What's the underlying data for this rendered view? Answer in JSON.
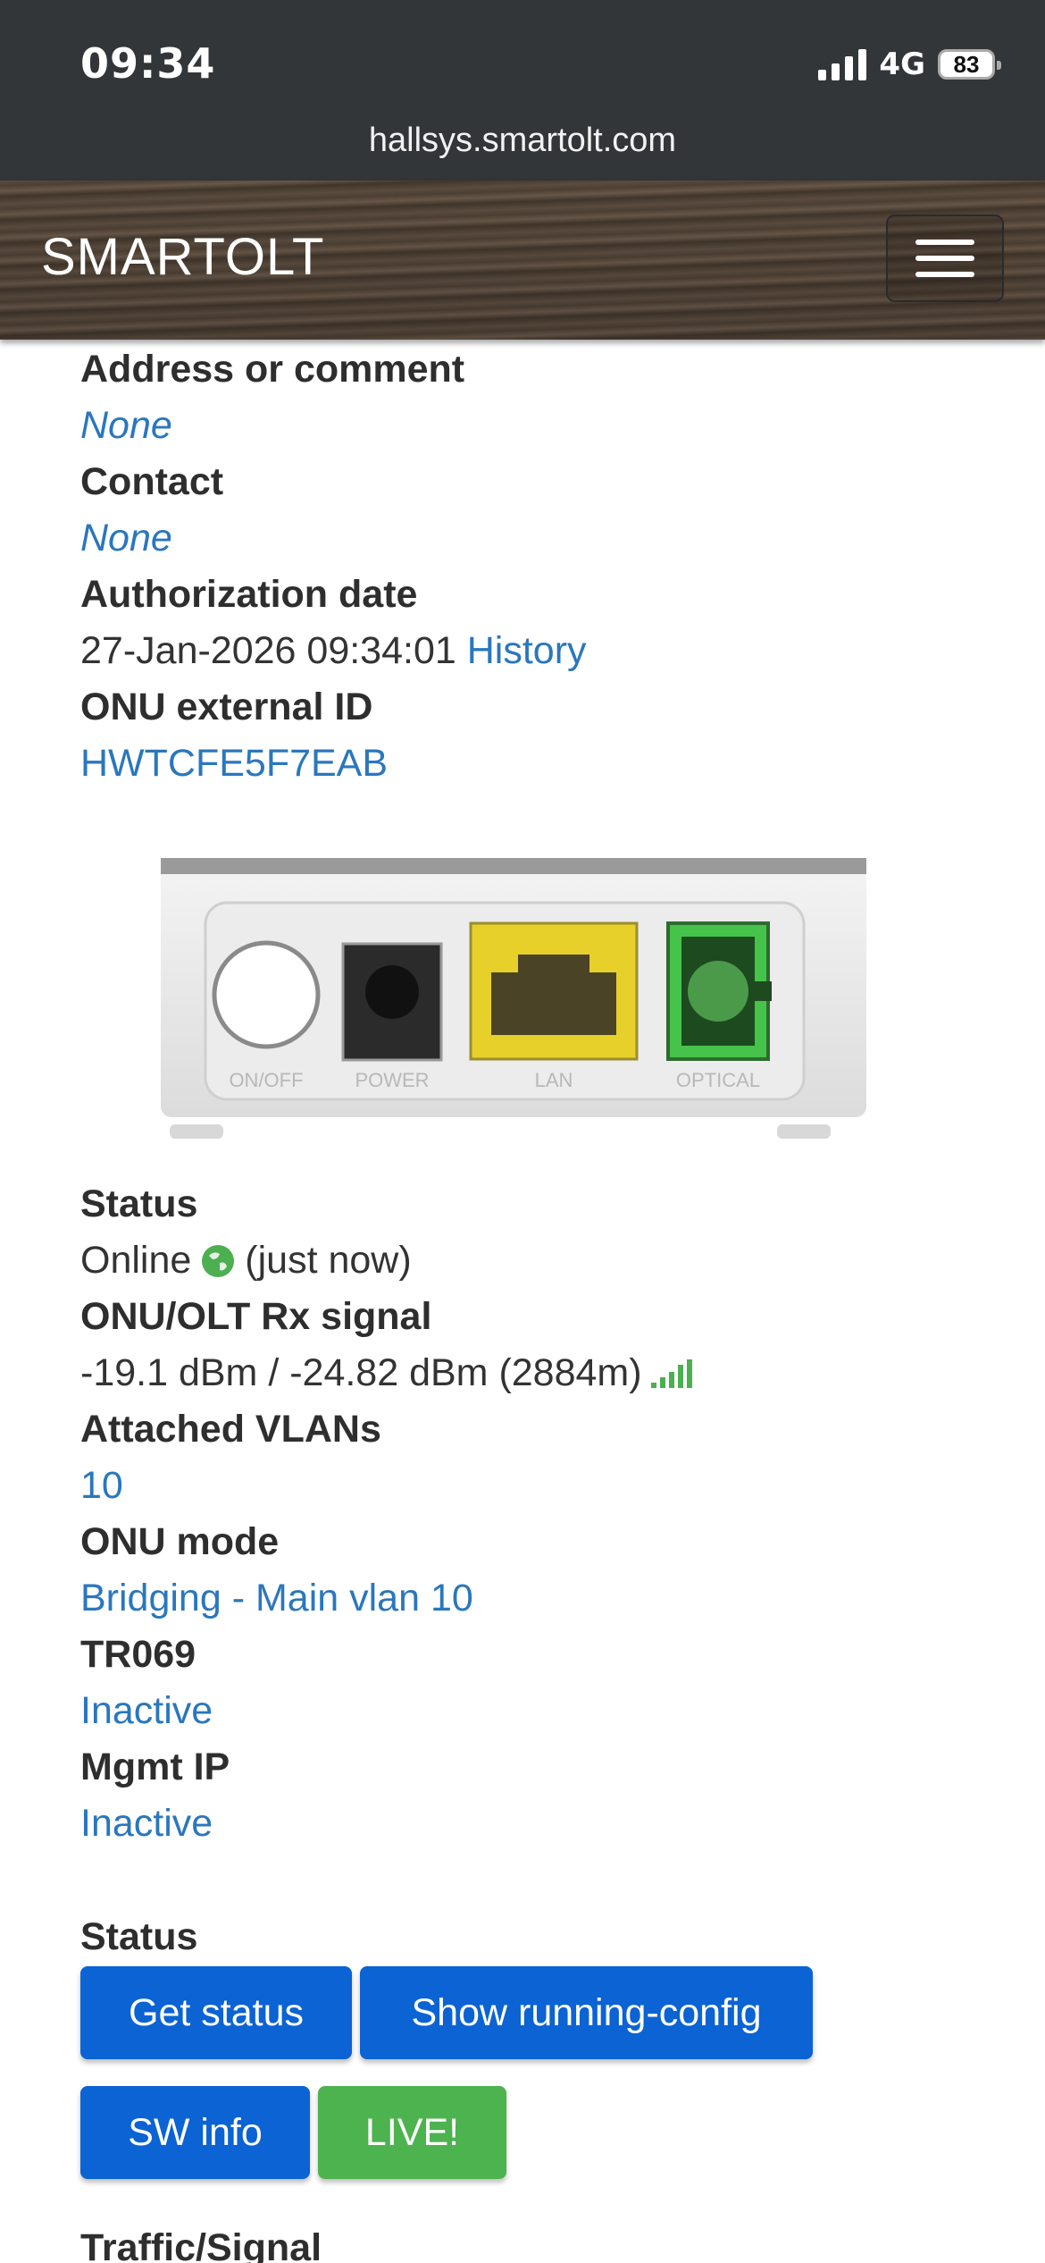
{
  "status_bar": {
    "time": "09:34",
    "network": "4G",
    "battery": "83"
  },
  "browser": {
    "url": "hallsys.smartolt.com"
  },
  "navbar": {
    "brand": "SMARTOLT"
  },
  "fields": {
    "address_label": "Address or comment",
    "address_value": "None",
    "contact_label": "Contact",
    "contact_value": "None",
    "auth_date_label": "Authorization date",
    "auth_date_value": "27-Jan-2026 09:34:01",
    "auth_history_link": "History",
    "ext_id_label": "ONU external ID",
    "ext_id_value": "HWTCFE5F7EAB",
    "status_label": "Status",
    "status_value": "Online",
    "status_time": "(just now)",
    "rx_label": "ONU/OLT Rx signal",
    "rx_value": "-19.1 dBm / -24.82 dBm (2884m)",
    "vlans_label": "Attached VLANs",
    "vlans_value": "10",
    "mode_label": "ONU mode",
    "mode_value": "Bridging - Main vlan 10",
    "tr069_label": "TR069",
    "tr069_value": "Inactive",
    "mgmt_label": "Mgmt IP",
    "mgmt_value": "Inactive"
  },
  "device_image": {
    "ports": [
      "ON/OFF",
      "POWER",
      "LAN",
      "OPTICAL"
    ]
  },
  "actions": {
    "section_label": "Status",
    "get_status": "Get status",
    "show_running_config": "Show running-config",
    "sw_info": "SW info",
    "live": "LIVE!"
  },
  "next_section": "Traffic/Signal",
  "colors": {
    "link": "#2a77bd",
    "button_blue": "#0b63d4",
    "button_green": "#4cb34e",
    "online_green": "#4caf50"
  }
}
